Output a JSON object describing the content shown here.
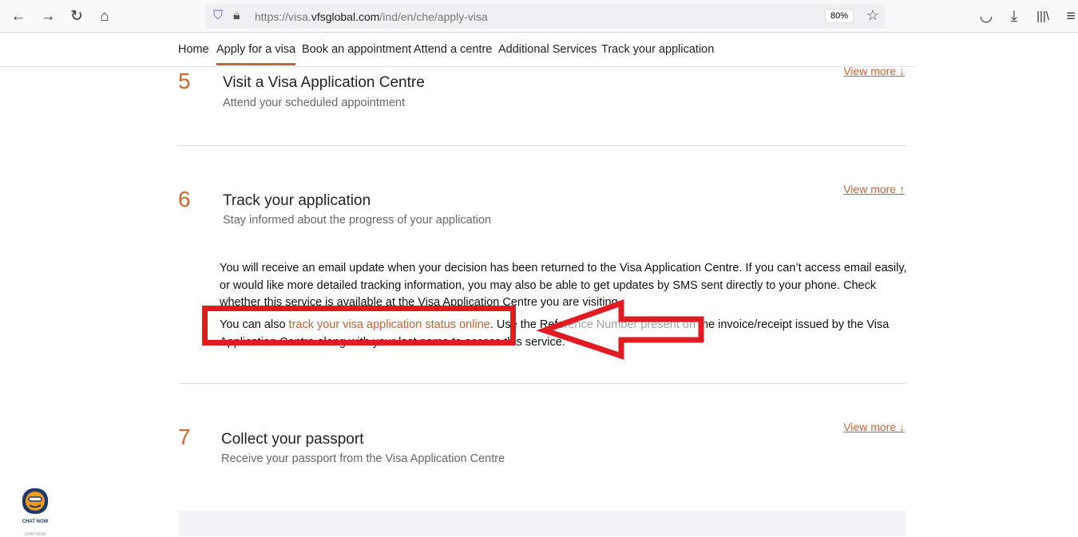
{
  "browser": {
    "url_prefix": "https://visa.",
    "url_domain": "vfsglobal.com",
    "url_path": "/ind/en/che/apply-visa",
    "zoom": "80%"
  },
  "nav": [
    "Home",
    "Apply for a visa",
    "Book an appointment",
    "Attend a centre",
    "Additional Services",
    "Track your application"
  ],
  "steps": [
    {
      "num": "5",
      "title": "Visit a Visa Application Centre",
      "subtitle": "Attend your scheduled appointment",
      "view_more": "View more ↓"
    },
    {
      "num": "6",
      "title": "Track your application",
      "subtitle": "Stay informed about the progress of your application",
      "view_more": "View more ↑"
    },
    {
      "num": "7",
      "title": "Collect your passport",
      "subtitle": "Receive your passport from the Visa Application Centre",
      "view_more": "View more ↓"
    }
  ],
  "details": {
    "para1": "You will receive an email update when your decision has been returned to the Visa Application Centre. If you can’t access email easily, or would like more detailed tracking information, you may also be able to get updates by SMS sent directly to your phone. Check whether this service is available at the Visa Application Centre you are visiting.",
    "para2_pre": "You can also ",
    "para2_link": "track your visa application status online",
    "para2_post": ". Use the Reference Number present on the invoice/receipt issued by the Visa Application Centre along with your last name to access this service."
  },
  "chat": {
    "label": "CHAT NOW",
    "sub": "CHAT NOW"
  },
  "colors": {
    "accent": "#c0643a",
    "annotation": "#e21b23"
  }
}
